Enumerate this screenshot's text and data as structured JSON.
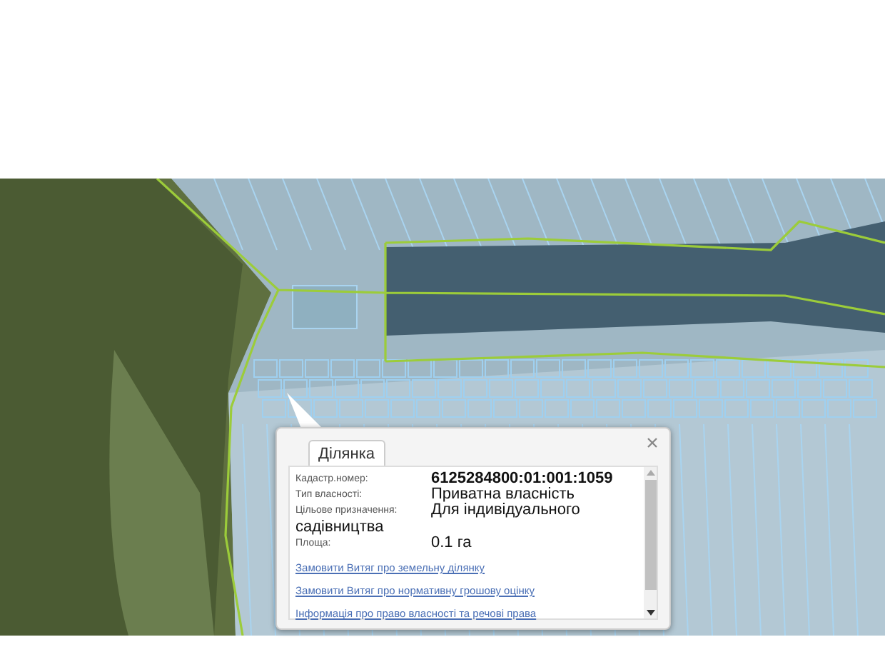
{
  "popup": {
    "tabs": [
      {
        "label": "Ділянка",
        "selected": true
      }
    ],
    "fields": [
      {
        "label": "Кадастр.номер:",
        "value": "6125284800:01:001:1059",
        "kind": "bold"
      },
      {
        "label": "Тип власності:",
        "value": "Приватна власність",
        "kind": "plain"
      },
      {
        "label": "Цільове призначення:",
        "value": "Для індивідуального",
        "value_wrap": "садівництва",
        "kind": "plain"
      },
      {
        "label": "Площа:",
        "value": "0.1 га",
        "kind": "plain"
      }
    ],
    "links": [
      "Замовити Витяг про земельну ділянку",
      "Замовити Витяг про нормативну грошову оцінку",
      "Інформація про право власності та речові права"
    ]
  }
}
